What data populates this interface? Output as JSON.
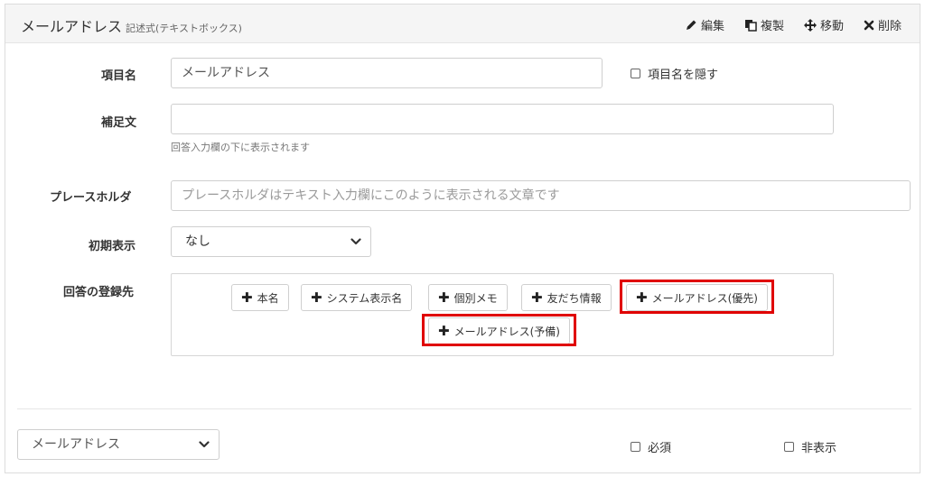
{
  "header": {
    "title": "メールアドレス",
    "subtitle": "記述式(テキストボックス)",
    "actions": {
      "edit": "編集",
      "duplicate": "複製",
      "move": "移動",
      "delete": "削除"
    },
    "icons": [
      "pencil-icon",
      "copy-icon",
      "move-icon",
      "times-icon"
    ]
  },
  "form": {
    "item_name": {
      "label": "項目名",
      "value": "メールアドレス",
      "hide_label": "項目名を隠す"
    },
    "supplement": {
      "label": "補足文",
      "value": "",
      "help": "回答入力欄の下に表示されます"
    },
    "placeholder": {
      "label": "プレースホルダ",
      "placeholder": "プレースホルダはテキスト入力欄にこのように表示される文章です"
    },
    "initial_display": {
      "label": "初期表示",
      "selected": "なし"
    },
    "destination": {
      "label": "回答の登録先",
      "buttons": [
        {
          "label": "本名"
        },
        {
          "label": "システム表示名"
        },
        {
          "label": "個別メモ"
        },
        {
          "label": "友だち情報"
        },
        {
          "label": "メールアドレス(優先)"
        },
        {
          "label": "メールアドレス(予備)"
        }
      ],
      "plus_glyph": "✚"
    }
  },
  "footer": {
    "preview_select": "メールアドレス",
    "required_label": "必須",
    "hidden_label": "非表示"
  },
  "colors": {
    "highlight": "#e00000",
    "header_bg": "#f5f5f5"
  }
}
